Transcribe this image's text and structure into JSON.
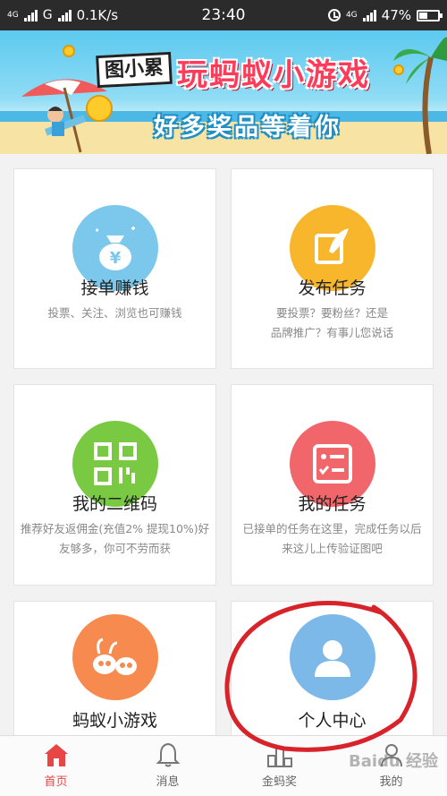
{
  "status_bar": {
    "net1": "4G",
    "net2": "G",
    "speed": "0.1K/s",
    "time": "23:40",
    "net3": "4G",
    "battery": "47%",
    "battery_level": 0.47
  },
  "banner": {
    "logo_text": "图小累",
    "title": "玩蚂蚁小游戏",
    "subtitle": "好多奖品等着你"
  },
  "cards": [
    {
      "title": "接单赚钱",
      "desc": "投票、关注、浏览也可赚钱",
      "icon": "money-bag-icon",
      "color": "#7cc8ec"
    },
    {
      "title": "发布任务",
      "desc": "要投票？要粉丝？还是\n品牌推广？有事儿您说话",
      "icon": "feather-icon",
      "color": "#f8b62d"
    },
    {
      "title": "我的二维码",
      "desc": "推荐好友返佣金(充值2% 提现10%)好\n友够多，你可不劳而获",
      "icon": "qr-code-icon",
      "color": "#7ac943"
    },
    {
      "title": "我的任务",
      "desc": "已接单的任务在这里，完成任务以后\n来这儿上传验证图吧",
      "icon": "task-list-icon",
      "color": "#f0666b"
    },
    {
      "title": "蚂蚁小游戏",
      "desc": "",
      "icon": "ant-game-icon",
      "color": "#f68a4f"
    },
    {
      "title": "个人中心",
      "desc": "",
      "icon": "user-avatar-icon",
      "color": "#7cb8e8"
    }
  ],
  "tabs": [
    {
      "label": "首页",
      "icon": "home-icon",
      "active": true
    },
    {
      "label": "消息",
      "icon": "bell-icon",
      "active": false
    },
    {
      "label": "金蚂奖",
      "icon": "podium-icon",
      "active": false
    },
    {
      "label": "我的",
      "icon": "user-icon",
      "active": false
    }
  ],
  "watermark": "Baidu 经验",
  "colors": {
    "accent": "#e84545",
    "annotation": "#d8232a"
  }
}
